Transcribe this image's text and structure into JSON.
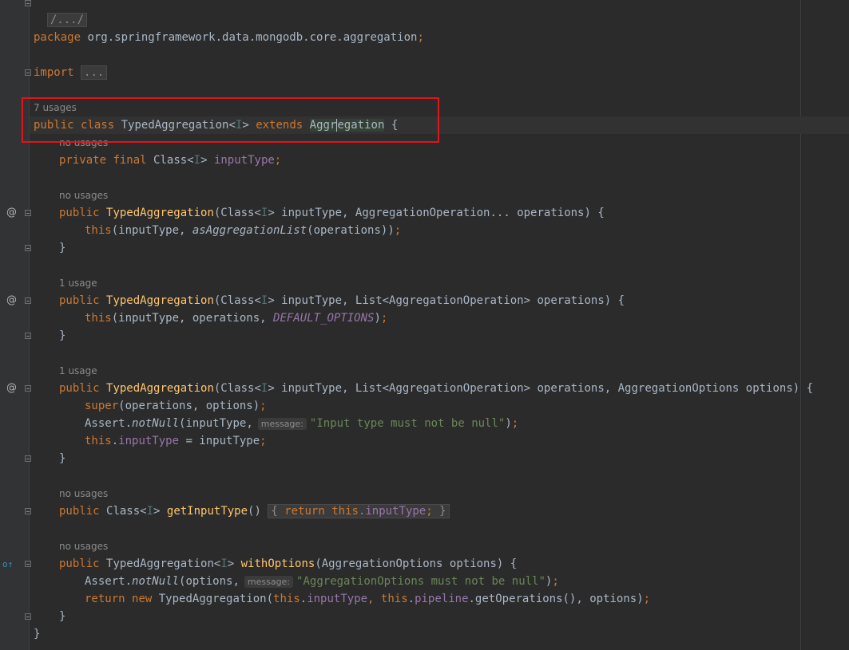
{
  "editor": {
    "lines": {
      "license": "/.../",
      "package_kw": "package",
      "package_name": " org.springframework.data.mongodb.core.aggregation",
      "import_kw": "import",
      "import_fold": "...",
      "usages_class": "7 usages",
      "class_public": "public",
      "class_class": "class",
      "class_name": "TypedAggregation",
      "class_type_param": "I",
      "class_extends": "extends",
      "class_super_a": "Aggr",
      "class_super_b": "egation",
      "usages_field": "no usages",
      "field_private": "private",
      "field_final": "final",
      "field_type": "Class",
      "field_type_param": "I",
      "field_name": "inputType",
      "usages_ctor1": "no usages",
      "ctor1_public": "public",
      "ctor1_name": "TypedAggregation",
      "ctor1_params_a": "(Class<",
      "ctor1_tp": "I",
      "ctor1_params_b": "> inputType, AggregationOperation... operations) {",
      "ctor1_this": "this",
      "ctor1_body_a": "(inputType, ",
      "ctor1_call": "asAggregationList",
      "ctor1_body_b": "(operations))",
      "usages_ctor2": "1 usage",
      "ctor2_public": "public",
      "ctor2_name": "TypedAggregation",
      "ctor2_params_a": "(Class<",
      "ctor2_tp": "I",
      "ctor2_params_b": "> inputType, List<AggregationOperation> operations) {",
      "ctor2_this": "this",
      "ctor2_body_a": "(inputType, operations, ",
      "ctor2_const": "DEFAULT_OPTIONS",
      "ctor2_body_b": ")",
      "usages_ctor3": "1 usage",
      "ctor3_public": "public",
      "ctor3_name": "TypedAggregation",
      "ctor3_params_a": "(Class<",
      "ctor3_tp": "I",
      "ctor3_params_b": "> inputType, List<AggregationOperation> operations, AggregationOptions options) {",
      "ctor3_super": "super",
      "ctor3_super_args": "(operations, options)",
      "ctor3_assert": "Assert.",
      "ctor3_notnull": "notNull",
      "ctor3_assert_a": "(inputType,",
      "ctor3_hint": "message:",
      "ctor3_msg": "\"Input type must not be null\"",
      "ctor3_assert_b": ")",
      "ctor3_this": "this",
      "ctor3_field": "inputType",
      "ctor3_assign": " = inputType",
      "usages_getter": "no usages",
      "getter_public": "public",
      "getter_type_a": "Class<",
      "getter_tp": "I",
      "getter_type_b": "> ",
      "getter_name": "getInputType",
      "getter_parens": "()",
      "getter_return": "return",
      "getter_this": "this",
      "getter_field": "inputType",
      "usages_with": "no usages",
      "with_public": "public",
      "with_type_a": "TypedAggregation<",
      "with_tp": "I",
      "with_type_b": "> ",
      "with_name": "withOptions",
      "with_params": "(AggregationOptions options) {",
      "with_assert": "Assert.",
      "with_notnull": "notNull",
      "with_assert_a": "(options,",
      "with_hint": "message:",
      "with_msg": "\"AggregationOptions must not be null\"",
      "with_assert_b": ")",
      "with_return": "return",
      "with_new": "new",
      "with_ctor": " TypedAggregation(",
      "with_this1": "this",
      "with_field1": "inputType",
      "with_this2": "this",
      "with_field2": "pipeline",
      "with_tail": ".getOperations(), options)",
      "close_class": "}"
    }
  },
  "gutter_icons": {
    "override_marker": "@",
    "implements_marker": "o↑"
  },
  "colors": {
    "background": "#2b2b2b",
    "keyword": "#cc7832",
    "method": "#ffc66d",
    "field": "#9876aa",
    "string": "#6a8759",
    "highlight_box": "#e0141b"
  }
}
